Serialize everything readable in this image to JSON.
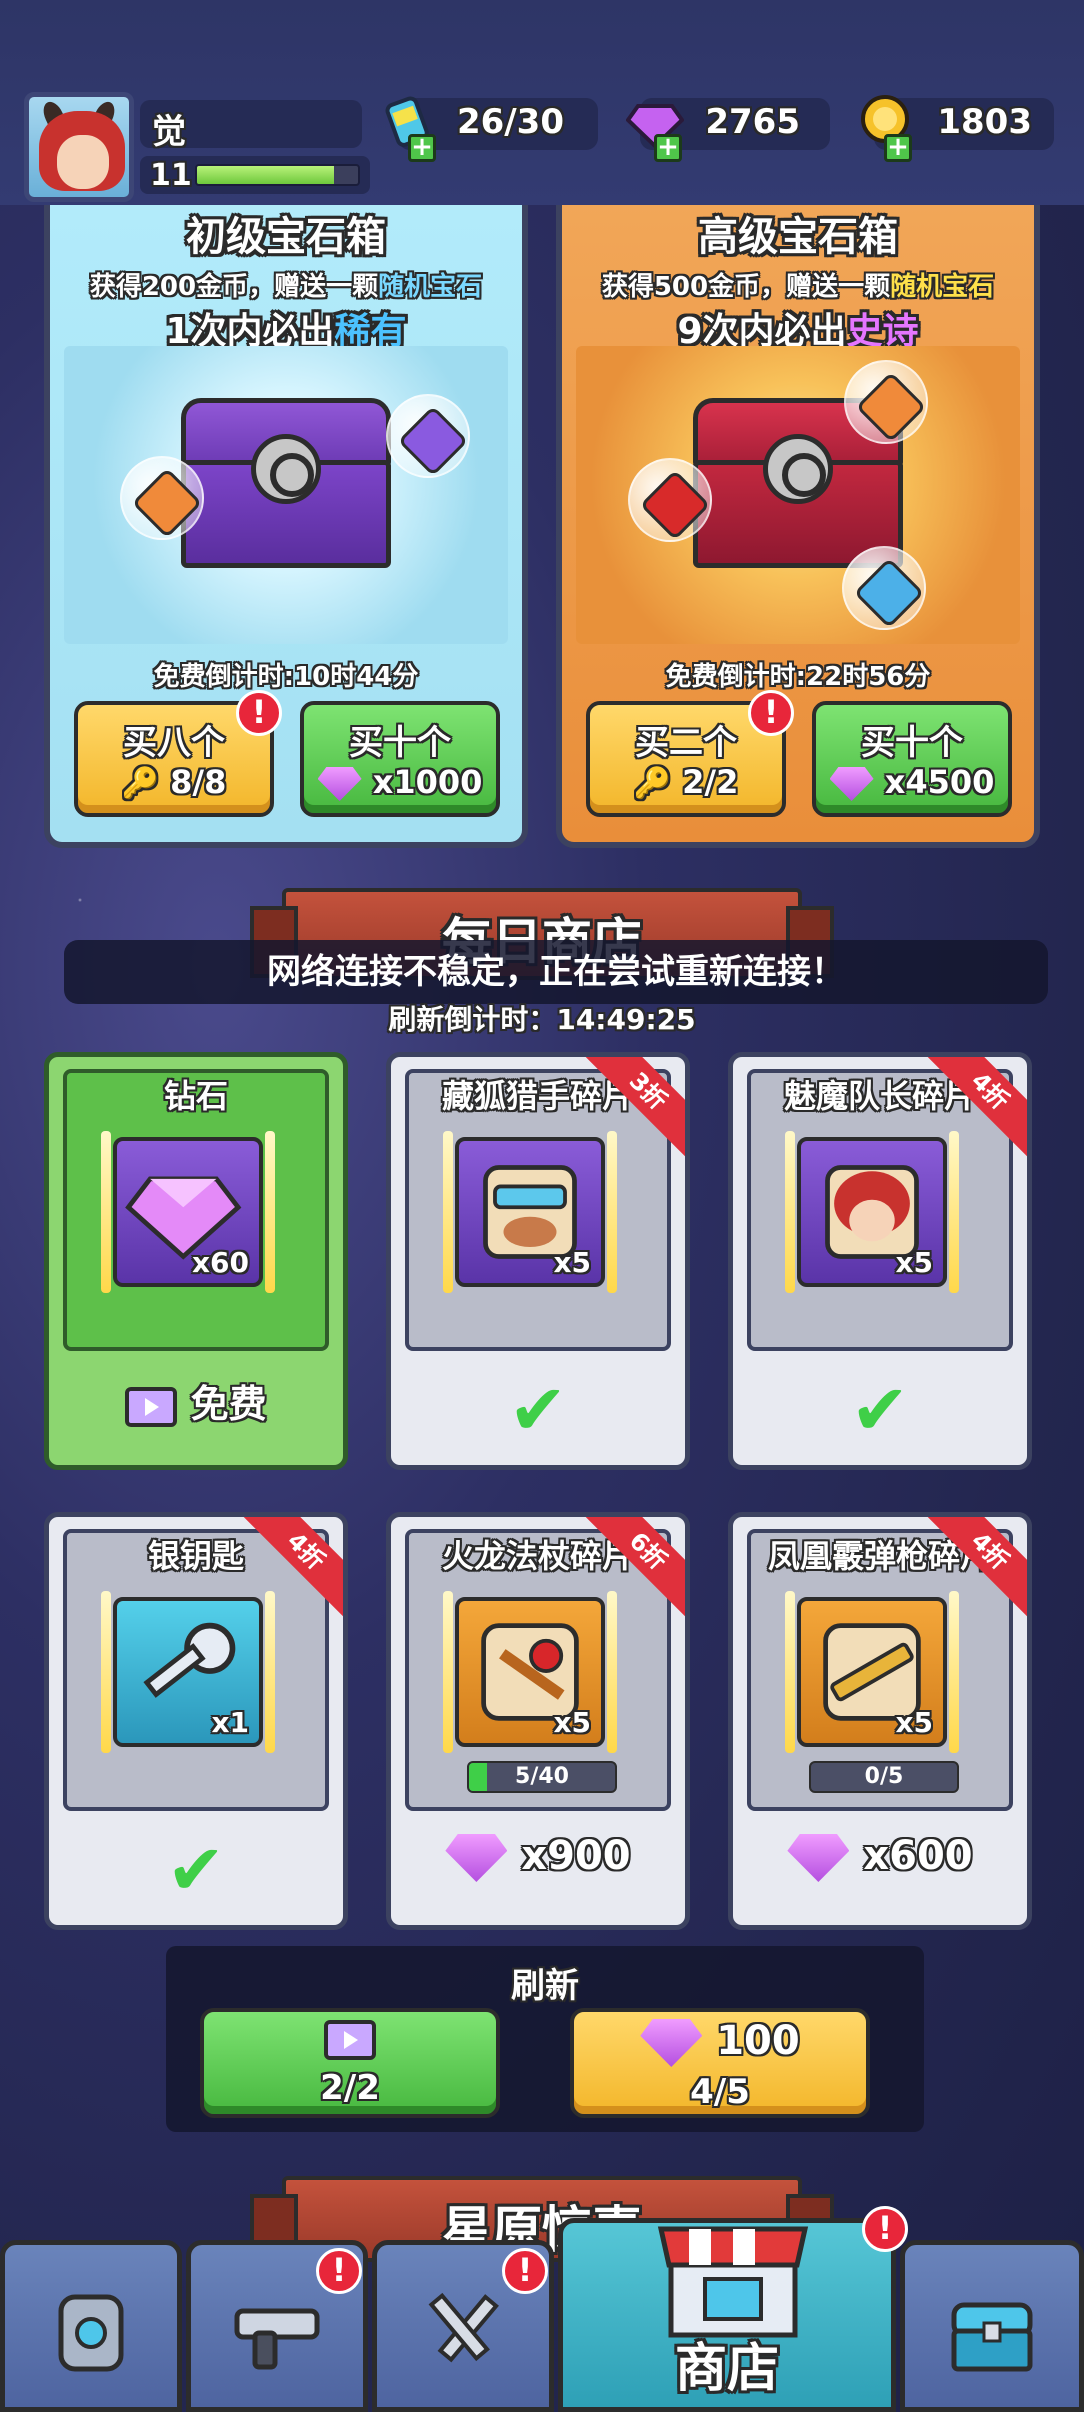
{
  "player": {
    "name": "觉",
    "level": "11",
    "level_progress": 0.85
  },
  "resources": {
    "energy": "26/30",
    "gems": "2765",
    "coins": "1803"
  },
  "chests": {
    "basic": {
      "title": "初级宝石箱",
      "desc_prefix": "获得200金币，赠送一颗",
      "desc_highlight": "随机宝石",
      "guarantee_prefix": "1次内必出",
      "guarantee_highlight": "稀有",
      "timer": "免费倒计时:10时44分",
      "buy_key_label": "买八个",
      "buy_key_count": "8/8",
      "buy_gem_label": "买十个",
      "buy_gem_price": "x1000"
    },
    "advanced": {
      "title": "高级宝石箱",
      "desc_prefix": "获得500金币，赠送一颗",
      "desc_highlight": "随机宝石",
      "guarantee_prefix": "9次内必出",
      "guarantee_highlight": "史诗",
      "timer": "免费倒计时:22时56分",
      "buy_key_label": "买二个",
      "buy_key_count": "2/2",
      "buy_gem_label": "买十个",
      "buy_gem_price": "x4500"
    },
    "badge": "!"
  },
  "daily_shop": {
    "banner": "每日商店",
    "toast": "网络连接不稳定，正在尝试重新连接！",
    "refresh_timer": "刷新倒计时：14:49:25",
    "items": [
      {
        "title": "钻石",
        "qty": "x60",
        "status": "免费"
      },
      {
        "title": "藏狐猎手碎片",
        "qty": "x5",
        "discount": "3折",
        "status": "purchased"
      },
      {
        "title": "魅魔队长碎片",
        "qty": "x5",
        "discount": "4折",
        "status": "purchased"
      },
      {
        "title": "银钥匙",
        "qty": "x1",
        "discount": "4折",
        "status": "purchased"
      },
      {
        "title": "火龙法杖碎片",
        "qty": "x5",
        "discount": "6折",
        "progress": "5/40",
        "progress_value": 0.125,
        "price": "x900"
      },
      {
        "title": "凤凰霰弹枪碎片",
        "qty": "x5",
        "discount": "4折",
        "progress": "0/5",
        "progress_value": 0,
        "price": "x600"
      }
    ],
    "check_mark": "✔"
  },
  "refresh": {
    "title": "刷新",
    "ad_count": "2/2",
    "gem_cost": "100",
    "gem_count": "4/5"
  },
  "next_banner": "星原惊喜",
  "nav": {
    "tabs": [
      {
        "icon": "armor-icon"
      },
      {
        "icon": "gun-icon",
        "badge": "!"
      },
      {
        "icon": "swords-icon",
        "badge": "!"
      },
      {
        "icon": "shop-icon",
        "label": "商店",
        "badge": "!"
      },
      {
        "icon": "chest-icon"
      }
    ]
  },
  "colors": {
    "background": "#2d2f63",
    "accent_green": "#47b83f",
    "accent_yellow": "#f3b62a",
    "badge_red": "#e8263a",
    "rare_blue": "#4cc2ff",
    "epic_purple": "#e576ff"
  }
}
